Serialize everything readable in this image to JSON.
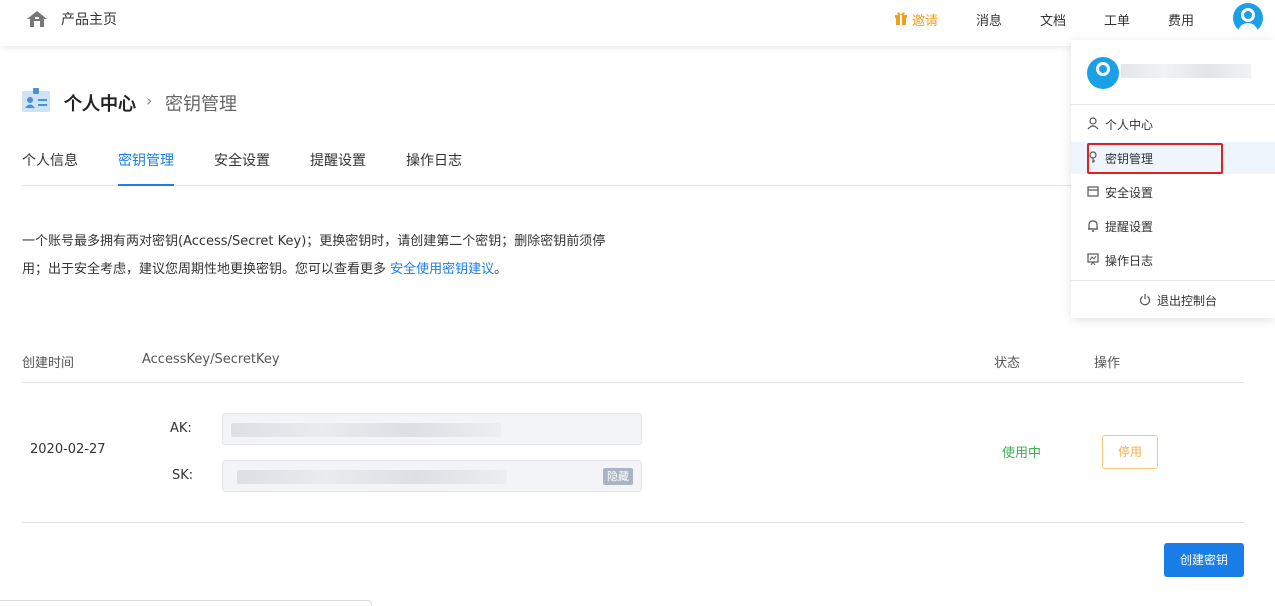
{
  "topbar": {
    "brand": "产品主页",
    "invite": "邀请",
    "messages": "消息",
    "docs": "文档",
    "tickets": "工单",
    "billing": "费用"
  },
  "page": {
    "title": "个人中心",
    "breadcrumb_sep": "›",
    "current": "密钥管理"
  },
  "tabs": [
    {
      "label": "个人信息"
    },
    {
      "label": "密钥管理"
    },
    {
      "label": "安全设置"
    },
    {
      "label": "提醒设置"
    },
    {
      "label": "操作日志"
    }
  ],
  "description": {
    "line1": "一个账号最多拥有两对密钥(Access/Secret Key)；更换密钥时，请创建第二个密钥；删除密钥前须停",
    "line2": "用；出于安全考虑，建议您周期性地更换密钥。您可以查看更多 ",
    "link": "安全使用密钥建议",
    "end": "。"
  },
  "table": {
    "headers": [
      "创建时间",
      "AccessKey/SecretKey",
      "状态",
      "操作"
    ],
    "rows": [
      {
        "created": "2020-02-27",
        "ak_label": "AK:",
        "sk_label": "SK:",
        "hide_label": "隐藏",
        "status": "使用中",
        "action": "停用"
      }
    ]
  },
  "create_button": "创建密钥",
  "dropdown": {
    "items": [
      {
        "label": "个人中心"
      },
      {
        "label": "密钥管理"
      },
      {
        "label": "安全设置"
      },
      {
        "label": "提醒设置"
      },
      {
        "label": "操作日志"
      }
    ],
    "logout": "退出控制台"
  },
  "colors": {
    "accent": "#1a7ee8",
    "status_active": "#3cae4d",
    "invite": "#f0a020",
    "highlight": "#e02020"
  }
}
